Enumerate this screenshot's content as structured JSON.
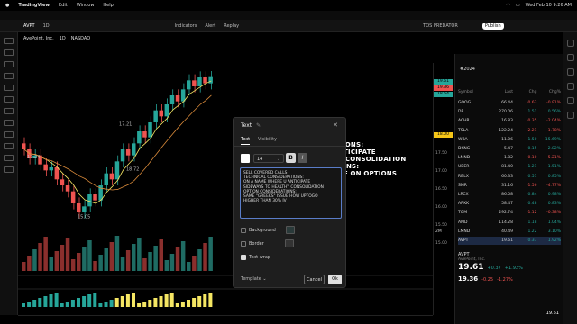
{
  "macbar": {
    "app": "TradingView",
    "menu": [
      "Edit",
      "Window",
      "Help"
    ],
    "datetime": "Wed Feb 10 9:26 AM"
  },
  "toolbar": {
    "symbol": "AVPT",
    "interval": "1D",
    "items": [
      "Indicators",
      "Alert",
      "Replay"
    ],
    "right_label": "TOS PREDATOR",
    "publish": "Publish"
  },
  "legend": {
    "name": "AvePoint, Inc.",
    "tf": "1D",
    "exchange": "NASDAQ"
  },
  "chart_data": {
    "type": "candlestick",
    "symbol": "AVPT",
    "ylim": [
      14.5,
      20.5
    ],
    "price_labels": [
      "19.61",
      "19.36",
      "18.64",
      "18.00",
      "17.50",
      "17.00",
      "16.50",
      "16.00",
      "15.50",
      "15.00"
    ],
    "candle_annotations": [
      "17.24",
      "18.72",
      "17.21",
      "15.05"
    ],
    "volume_label": "2M"
  },
  "overlay": {
    "lines": [
      "TIONS:",
      "NTICIPATE",
      "Y CONSOLIDATION",
      "IONS:",
      "UE ON OPTIONS"
    ]
  },
  "watchlist": {
    "title": "#2024",
    "columns": [
      "Symbol",
      "Last",
      "Chg",
      "Chg%"
    ],
    "rows": [
      {
        "sym": "GOOG",
        "last": "66.44",
        "chg": "-0.63",
        "pct": "-0.91%",
        "dir": "down"
      },
      {
        "sym": "DE",
        "last": "270.06",
        "chg": "1.51",
        "pct": "0.56%",
        "dir": "up"
      },
      {
        "sym": "ACHR",
        "last": "16.83",
        "chg": "-0.35",
        "pct": "-2.04%",
        "dir": "down"
      },
      {
        "sym": "TSLA",
        "last": "122.24",
        "chg": "-2.21",
        "pct": "-1.78%",
        "dir": "down"
      },
      {
        "sym": "WBA",
        "last": "11.06",
        "chg": "1.50",
        "pct": "15.69%",
        "dir": "up"
      },
      {
        "sym": "DKNG",
        "last": "5.47",
        "chg": "0.15",
        "pct": "2.82%",
        "dir": "up"
      },
      {
        "sym": "LMND",
        "last": "1.82",
        "chg": "-0.10",
        "pct": "-5.21%",
        "dir": "down"
      },
      {
        "sym": "UBER",
        "last": "81.40",
        "chg": "1.21",
        "pct": "1.51%",
        "dir": "up"
      },
      {
        "sym": "RBLX",
        "last": "60.33",
        "chg": "0.51",
        "pct": "0.85%",
        "dir": "up"
      },
      {
        "sym": "SMR",
        "last": "31.16",
        "chg": "-1.56",
        "pct": "-4.77%",
        "dir": "down"
      },
      {
        "sym": "LRCX",
        "last": "86.08",
        "chg": "0.84",
        "pct": "0.98%",
        "dir": "up"
      },
      {
        "sym": "ARKK",
        "last": "58.47",
        "chg": "0.48",
        "pct": "0.83%",
        "dir": "up"
      },
      {
        "sym": "TGM",
        "last": "292.74",
        "chg": "-1.12",
        "pct": "-0.38%",
        "dir": "down"
      },
      {
        "sym": "AMD",
        "last": "114.28",
        "chg": "1.18",
        "pct": "1.04%",
        "dir": "up"
      },
      {
        "sym": "LMND",
        "last": "40.49",
        "chg": "1.22",
        "pct": "3.10%",
        "dir": "up"
      },
      {
        "sym": "AVPT",
        "last": "19.61",
        "chg": "0.37",
        "pct": "1.92%",
        "dir": "up"
      }
    ],
    "detail": {
      "sym": "AVPT",
      "name": "AvePoint, Inc.",
      "price": "19.61",
      "chg": "+0.37",
      "pct": "+1.92%",
      "ah_price": "19.36",
      "ah_chg": "-0.25",
      "ah_pct": "-1.27%",
      "foot": "19.61"
    }
  },
  "dialog": {
    "title": "Text",
    "tabs": [
      "Text",
      "Visibility"
    ],
    "font_size": "14",
    "bold": "B",
    "italic": "I",
    "text": "SELL COVERED CALLS\nTECHNICAL CONSIDERATIONS:\nON A NAME WHERE U ANTICIPATE\nSIDEWAYS TO HEALTHY CONSOLIDATION\nOPTION CONSIDERATIONS:\nSAME \"GREEKS\" ISSUE HOW UPTOGO\nHIGHER THAN 30% IV",
    "background": "Background",
    "border": "Border",
    "wrap": "Text wrap",
    "template": "Template",
    "cancel": "Cancel",
    "ok": "Ok"
  },
  "colors": {
    "up": "#26a69a",
    "down": "#ef5350",
    "accent": "#2962ff"
  }
}
